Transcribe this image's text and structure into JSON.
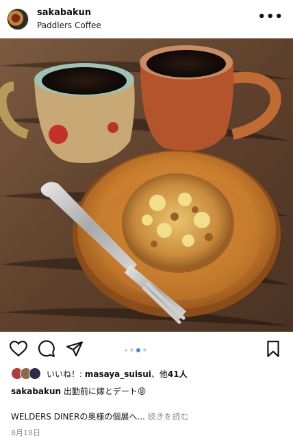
{
  "header": {
    "username": "sakabakun",
    "location": "Paddlers Coffee",
    "more_icon": "more-dots-icon"
  },
  "post": {
    "photo_subject": "coffee-and-pastry-photo",
    "carousel": {
      "dot_count": 4,
      "active_index": 2
    }
  },
  "actions": {
    "like_icon": "heart-icon",
    "comment_icon": "comment-icon",
    "share_icon": "send-icon",
    "save_icon": "bookmark-icon"
  },
  "likes": {
    "prefix": "いいね！: ",
    "user": "masaya_suisui",
    "suffix": "、他",
    "count": "41人"
  },
  "caption": {
    "user": "sakabakun",
    "text": " 出勤前に嫁とデート😝"
  },
  "extra": {
    "text": "WELDERS DINERの奥様の個展へ... ",
    "read_more": "続きを読む"
  },
  "date": "8月18日"
}
